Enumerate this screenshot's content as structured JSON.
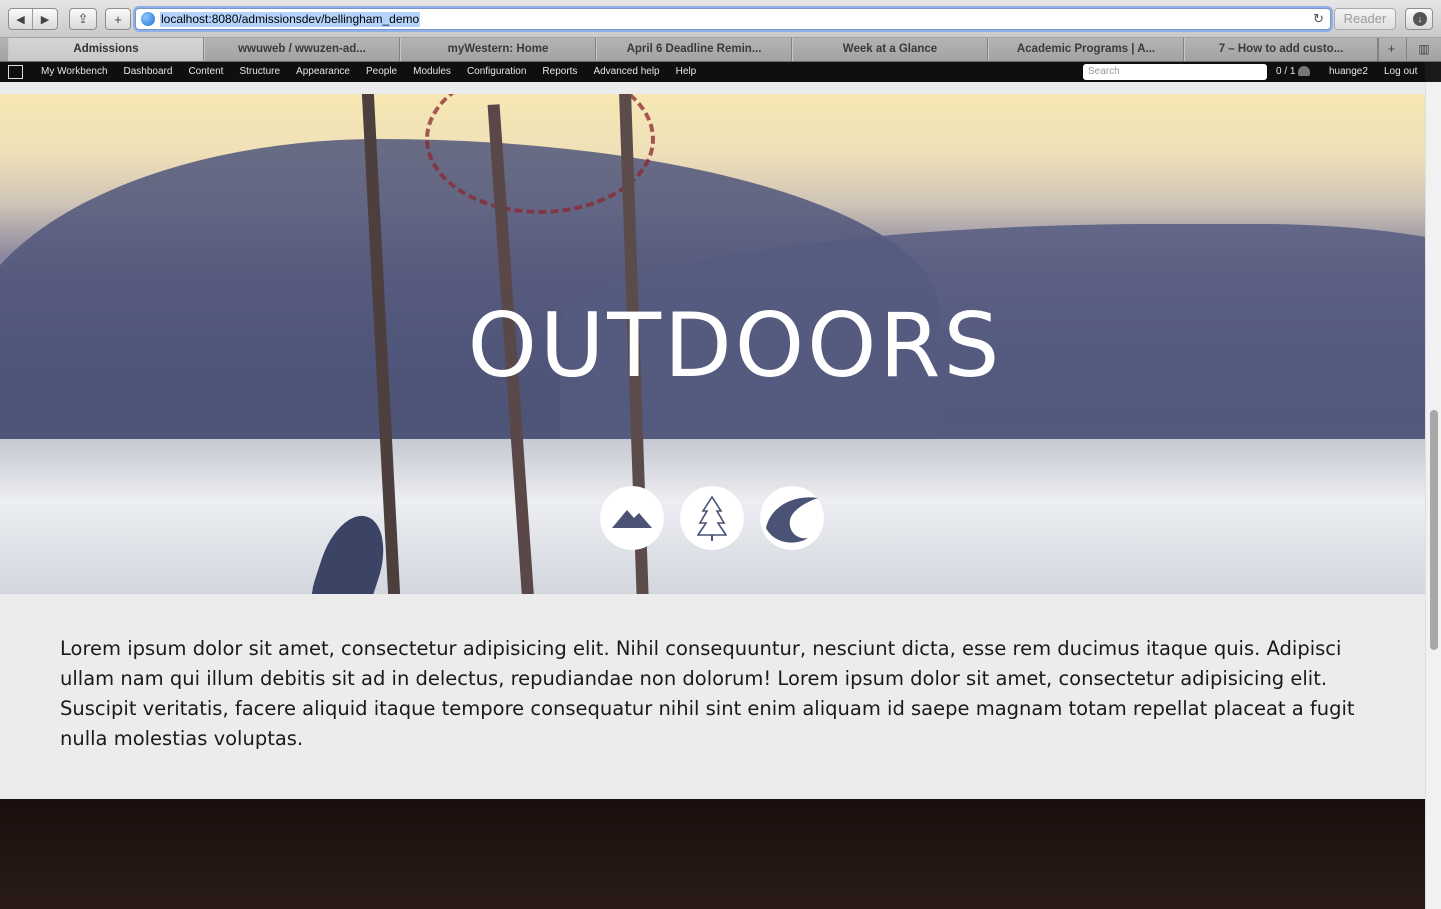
{
  "browser": {
    "url": "localhost:8080/admissionsdev/bellingham_demo",
    "reader_label": "Reader",
    "tabs": [
      {
        "label": "Admissions",
        "active": true
      },
      {
        "label": "wwuweb / wwuzen-ad...",
        "active": false
      },
      {
        "label": "myWestern: Home",
        "active": false
      },
      {
        "label": "April 6 Deadline Remin...",
        "active": false
      },
      {
        "label": "Week at a Glance",
        "active": false
      },
      {
        "label": "Academic Programs | A...",
        "active": false
      },
      {
        "label": "7 – How to add custo...",
        "active": false
      }
    ]
  },
  "admin_bar": {
    "menu": [
      "My Workbench",
      "Dashboard",
      "Content",
      "Structure",
      "Appearance",
      "People",
      "Modules",
      "Configuration",
      "Reports",
      "Advanced help",
      "Help"
    ],
    "search_placeholder": "Search",
    "users_count": "0 / 1",
    "username": "huange2",
    "logout": "Log out"
  },
  "hero": {
    "title": "OUTDOORS",
    "icons": [
      "mountain-icon",
      "tree-icon",
      "wave-icon"
    ]
  },
  "intro": {
    "text": "Lorem ipsum dolor sit amet, consectetur adipisicing elit. Nihil consequuntur, nesciunt dicta, esse rem ducimus itaque quis. Adipisci ullam nam qui illum debitis sit ad in delectus, repudiandae non dolorum! Lorem ipsum dolor sit amet, consectetur adipisicing elit. Suscipit veritatis, facere aliquid itaque tempore consequatur nihil sint enim aliquam id saepe magnam totam repellat placeat a fugit nulla molestias voluptas."
  },
  "colors": {
    "hero_title": "#ffffff",
    "admin_bar_bg": "#0f0f0f",
    "page_bg": "#ececec",
    "icon_fill": "#4a5275"
  }
}
